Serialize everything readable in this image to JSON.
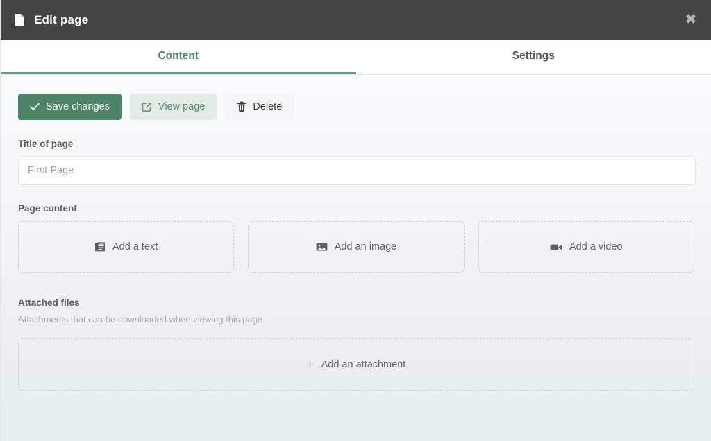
{
  "header": {
    "title": "Edit page",
    "doc_icon": "document-icon",
    "close_icon": "close-icon",
    "close_label": "✖",
    "bg_color": "#444444"
  },
  "tabs": [
    {
      "label": "Content",
      "active": true,
      "name": "tab-content"
    },
    {
      "label": "Settings",
      "active": false,
      "name": "tab-settings"
    }
  ],
  "accent_color": "#4c8465",
  "actions": {
    "save": {
      "label": "Save changes",
      "icon": "check-icon"
    },
    "view": {
      "label": "View page",
      "icon": "external-link-icon"
    },
    "delete": {
      "label": "Delete",
      "icon": "trash-icon"
    }
  },
  "title_field": {
    "label": "Title of page",
    "value": "",
    "placeholder": "First Page"
  },
  "page_content": {
    "label": "Page content",
    "blocks": [
      {
        "label": "Add a text",
        "icon": "text-block-icon"
      },
      {
        "label": "Add an image",
        "icon": "image-icon"
      },
      {
        "label": "Add a video",
        "icon": "video-camera-icon"
      }
    ]
  },
  "attachments": {
    "heading": "Attached files",
    "subtitle": "Attachments that can be downloaded when viewing this page",
    "add_label": "Add an attachment",
    "add_icon": "plus-icon",
    "plus_glyph": "+"
  }
}
